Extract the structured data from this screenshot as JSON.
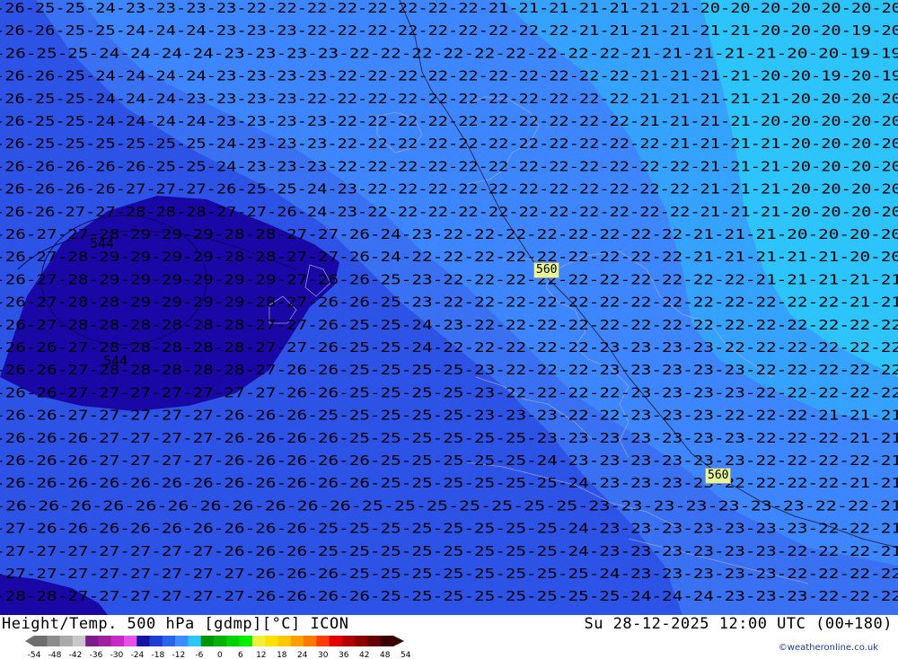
{
  "footer": {
    "title": "Height/Temp. 500 hPa [gdmp][°C] ICON",
    "timestamp": "Su 28-12-2025 12:00 UTC (00+180)",
    "credit": "©weatheronline.co.uk"
  },
  "height_labels": [
    "560",
    "560"
  ],
  "low_label": "544",
  "low_label_2": "544",
  "colorbar": {
    "ticks": [
      "-54",
      "-48",
      "-42",
      "-36",
      "-30",
      "-24",
      "-18",
      "-12",
      "-6",
      "0",
      "6",
      "12",
      "18",
      "24",
      "30",
      "36",
      "42",
      "48",
      "54"
    ],
    "colors": [
      "#6e6e6e",
      "#8c8c8c",
      "#aaaaaa",
      "#c8c8c8",
      "#7a1e8c",
      "#a020a0",
      "#c828c8",
      "#e650e6",
      "#1414a0",
      "#1e3cd2",
      "#2864f0",
      "#3c8cff",
      "#28c8ff",
      "#009600",
      "#00b400",
      "#00d200",
      "#00f000",
      "#f0f03c",
      "#ffe100",
      "#ffc800",
      "#ffa000",
      "#ff7800",
      "#ff3c00",
      "#e60000",
      "#b40000",
      "#8c0000",
      "#640000",
      "#3c0000"
    ],
    "colors_meaning": "temperature color scale"
  },
  "zones": {
    "deep": "#1a08a6",
    "band26": "#2c52e6",
    "band24": "#3a70f2",
    "band23": "#3e86ff",
    "band21": "#36a2ff",
    "band20": "#2cc4fb"
  },
  "contour_rows": [
    "-26-25-25-24-23-23-23-23-22-22-22-22-22-22-22-22-21-21-21-21-21-21-21-20-20-20-20-20-20-20",
    "-26-26-25-25-24-24-24-23-23-23-22-22-22-22-22-22-22-22-22-21-21-21-21-21-21-20-20-20-19-20",
    "-26-25-25-24-24-24-24-23-23-23-23-22-22-22-22-22-22-22-22-22-21-21-21-21-21-20-20-19-19",
    "-26-26-25-24-24-24-24-23-23-23-23-22-22-22-22-22-22-22-22-22-22-21-21-21-21-20-20-19-20-19",
    "-26-25-25-24-24-24-23-23-23-23-22-22-22-22-22-22-22-22-22-22-22-21-21-21-21-21-20-20-20-20",
    "-26-25-25-24-24-24-24-23-23-23-23-22-22-22-22-22-22-22-22-22-22-21-21-21-21-20-20-20-20-20",
    "-26-25-25-25-25-25-25-24-23-23-23-22-22-22-22-22-22-22-22-22-22-22-21-21-21-21-20-20-20-20",
    "-26-26-26-26-26-25-25-24-23-23-23-22-22-22-22-22-22-22-22-22-22-22-22-21-21-21-20-20-20-20",
    "-26-26-26-26-27-27-27-26-25-25-24-23-22-22-22-22-22-22-22-22-22-22-22-21-21-21-20-20-20-20",
    "-26-26-27-27-28-28-28-27-27-26-24-23-22-22-22-22-22-22-22-22-22-22-22-21-21-21-20-20-20-20",
    "-26-27-27-28-29-29-29-28-28-27-27-26-24-23-22-22-22-22-22-22-22-22-21-21-21-20-20-20-20",
    "-26-27-28-29-29-29-29-28-28-27-27-26-24-22-22-22-22-22-22-22-22-22-21-21-21-21-21-20-20",
    "-26-27-28-29-29-29-29-29-29-27-26-26-25-23-22-22-22-22-22-22-22-22-22-22-21-21-21-21-21",
    "-26-27-28-28-29-29-29-29-28-27-26-26-25-23-22-22-22-22-22-22-22-22-22-22-22-22-22-21-21",
    "-26-27-28-28-28-28-28-28-27-27-26-25-25-24-23-22-22-22-22-22-22-22-22-22-22-22-22-22-22",
    "-26-26-27-28-28-28-28-28-27-27-26-25-25-24-22-22-22-22-22-23-23-23-23-22-22-22-22-22-22",
    "-26-26-27-28-28-28-28-28-27-26-26-25-25-25-25-23-22-22-22-23-23-23-23-23-22-22-22-22-22",
    "-26-26-27-27-27-27-27-27-27-26-26-25-25-25-25-23-22-22-22-22-23-23-23-23-22-22-22-22-22",
    "-26-26-27-27-27-27-27-26-26-26-25-25-25-25-25-23-23-23-22-22-23-23-23-22-22-22-21-21-21",
    "-26-26-26-27-27-27-27-26-26-26-26-25-25-25-25-25-25-23-23-23-23-23-23-23-22-22-22-21-21",
    "-26-26-26-27-27-27-27-26-26-26-26-26-25-25-25-25-25-24-23-23-23-23-23-23-22-22-22-22-21",
    "-26-26-26-26-26-26-26-26-26-26-26-26-25-25-25-25-25-25-24-23-23-23-23-22-22-22-22-21-21",
    "-26-26-26-26-26-26-26-26-26-26-26-25-25-25-25-25-25-25-23-23-23-23-23-23-23-22-22-21",
    "-27-26-26-26-26-26-26-26-26-26-25-25-25-25-25-25-25-25-24-23-23-23-23-23-23-23-22-22-21",
    "-27-27-27-27-27-27-27-26-26-26-25-25-25-25-25-25-25-25-24-23-23-23-23-23-23-22-22-22-21",
    "-27-27-27-27-27-27-27-27-26-26-26-25-25-25-25-25-25-25-25-24-23-23-23-23-23-22-22-22-22",
    "-28-28-27-27-27-27-27-27-26-26-26-26-25-25-25-25-25-25-25-25-24-24-24-23-23-23-22-22-22"
  ]
}
